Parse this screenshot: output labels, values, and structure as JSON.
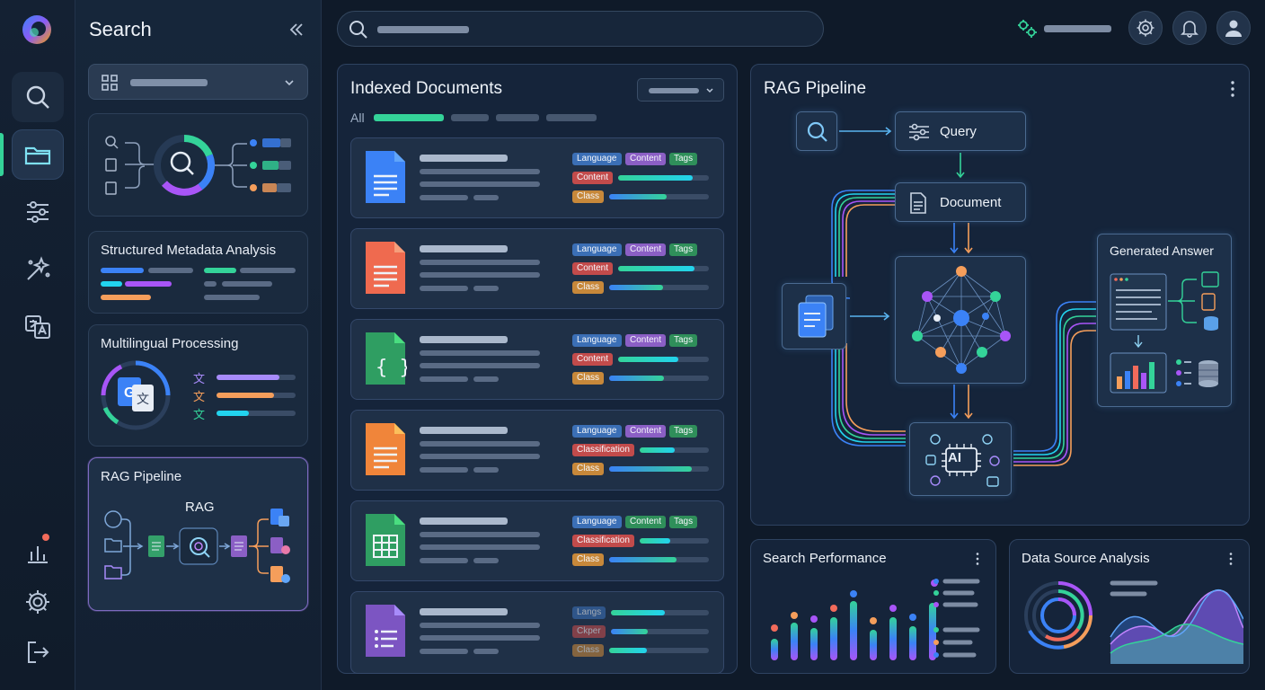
{
  "sidebar": {
    "title": "Search",
    "cards": [
      {
        "title": "Structured Metadata Analysis"
      },
      {
        "title": "Multilingual Processing"
      },
      {
        "title": "RAG Pipeline",
        "diagram_label": "RAG"
      }
    ]
  },
  "rail": {
    "items": [
      {
        "icon": "search-icon"
      },
      {
        "icon": "folder-icon"
      },
      {
        "icon": "sliders-icon"
      },
      {
        "icon": "sparkle-icon"
      },
      {
        "icon": "translate-icon"
      },
      {
        "icon": "analytics-icon"
      },
      {
        "icon": "gear-icon"
      },
      {
        "icon": "logout-icon"
      }
    ]
  },
  "indexed": {
    "title": "Indexed Documents",
    "filter_all": "All",
    "documents": [
      {
        "icon": "doc-blue",
        "tags": [
          [
            "Language",
            "blue"
          ],
          [
            "Content",
            "purple"
          ],
          [
            "Tags",
            "green"
          ],
          [
            "Content",
            "red"
          ],
          [
            "Class",
            "orange"
          ]
        ],
        "progress": [
          0.82,
          0.58
        ]
      },
      {
        "icon": "doc-red",
        "tags": [
          [
            "Language",
            "blue"
          ],
          [
            "Content",
            "purple"
          ],
          [
            "Tags",
            "green"
          ],
          [
            "Content",
            "red"
          ],
          [
            "Class",
            "orange"
          ]
        ],
        "progress": [
          0.84,
          0.54
        ]
      },
      {
        "icon": "doc-green",
        "tags": [
          [
            "Language",
            "blue"
          ],
          [
            "Content",
            "purple"
          ],
          [
            "Tags",
            "green"
          ],
          [
            "Content",
            "red"
          ],
          [
            "Class",
            "orange"
          ]
        ],
        "progress": [
          0.66,
          0.55
        ]
      },
      {
        "icon": "doc-orange",
        "tags": [
          [
            "Language",
            "blue"
          ],
          [
            "Content",
            "purple"
          ],
          [
            "Tags",
            "green"
          ],
          [
            "Classification",
            "red"
          ],
          [
            "Class",
            "orange"
          ]
        ],
        "progress": [
          0.5,
          0.83
        ]
      },
      {
        "icon": "doc-sheet",
        "tags": [
          [
            "Language",
            "blue"
          ],
          [
            "Content",
            "green"
          ],
          [
            "Tags",
            "green"
          ],
          [
            "Classification",
            "red"
          ],
          [
            "Class",
            "orange"
          ]
        ],
        "progress": [
          0.44,
          0.68
        ]
      },
      {
        "icon": "doc-purple",
        "tags": [
          [
            "Langs",
            "blue"
          ],
          [
            "Ckper",
            "red"
          ],
          [
            "Class",
            "orange"
          ]
        ],
        "progress": [
          0.55,
          0.38
        ]
      }
    ]
  },
  "rag": {
    "title": "RAG Pipeline",
    "query": "Query",
    "document": "Document",
    "answer": "Generated Answer",
    "ai": "AI"
  },
  "performance": {
    "title": "Search Performance"
  },
  "datasource": {
    "title": "Data Source Analysis"
  },
  "colors": {
    "accent": "#34d399",
    "purple": "#8b5fc5",
    "blue": "#3b82f6"
  }
}
